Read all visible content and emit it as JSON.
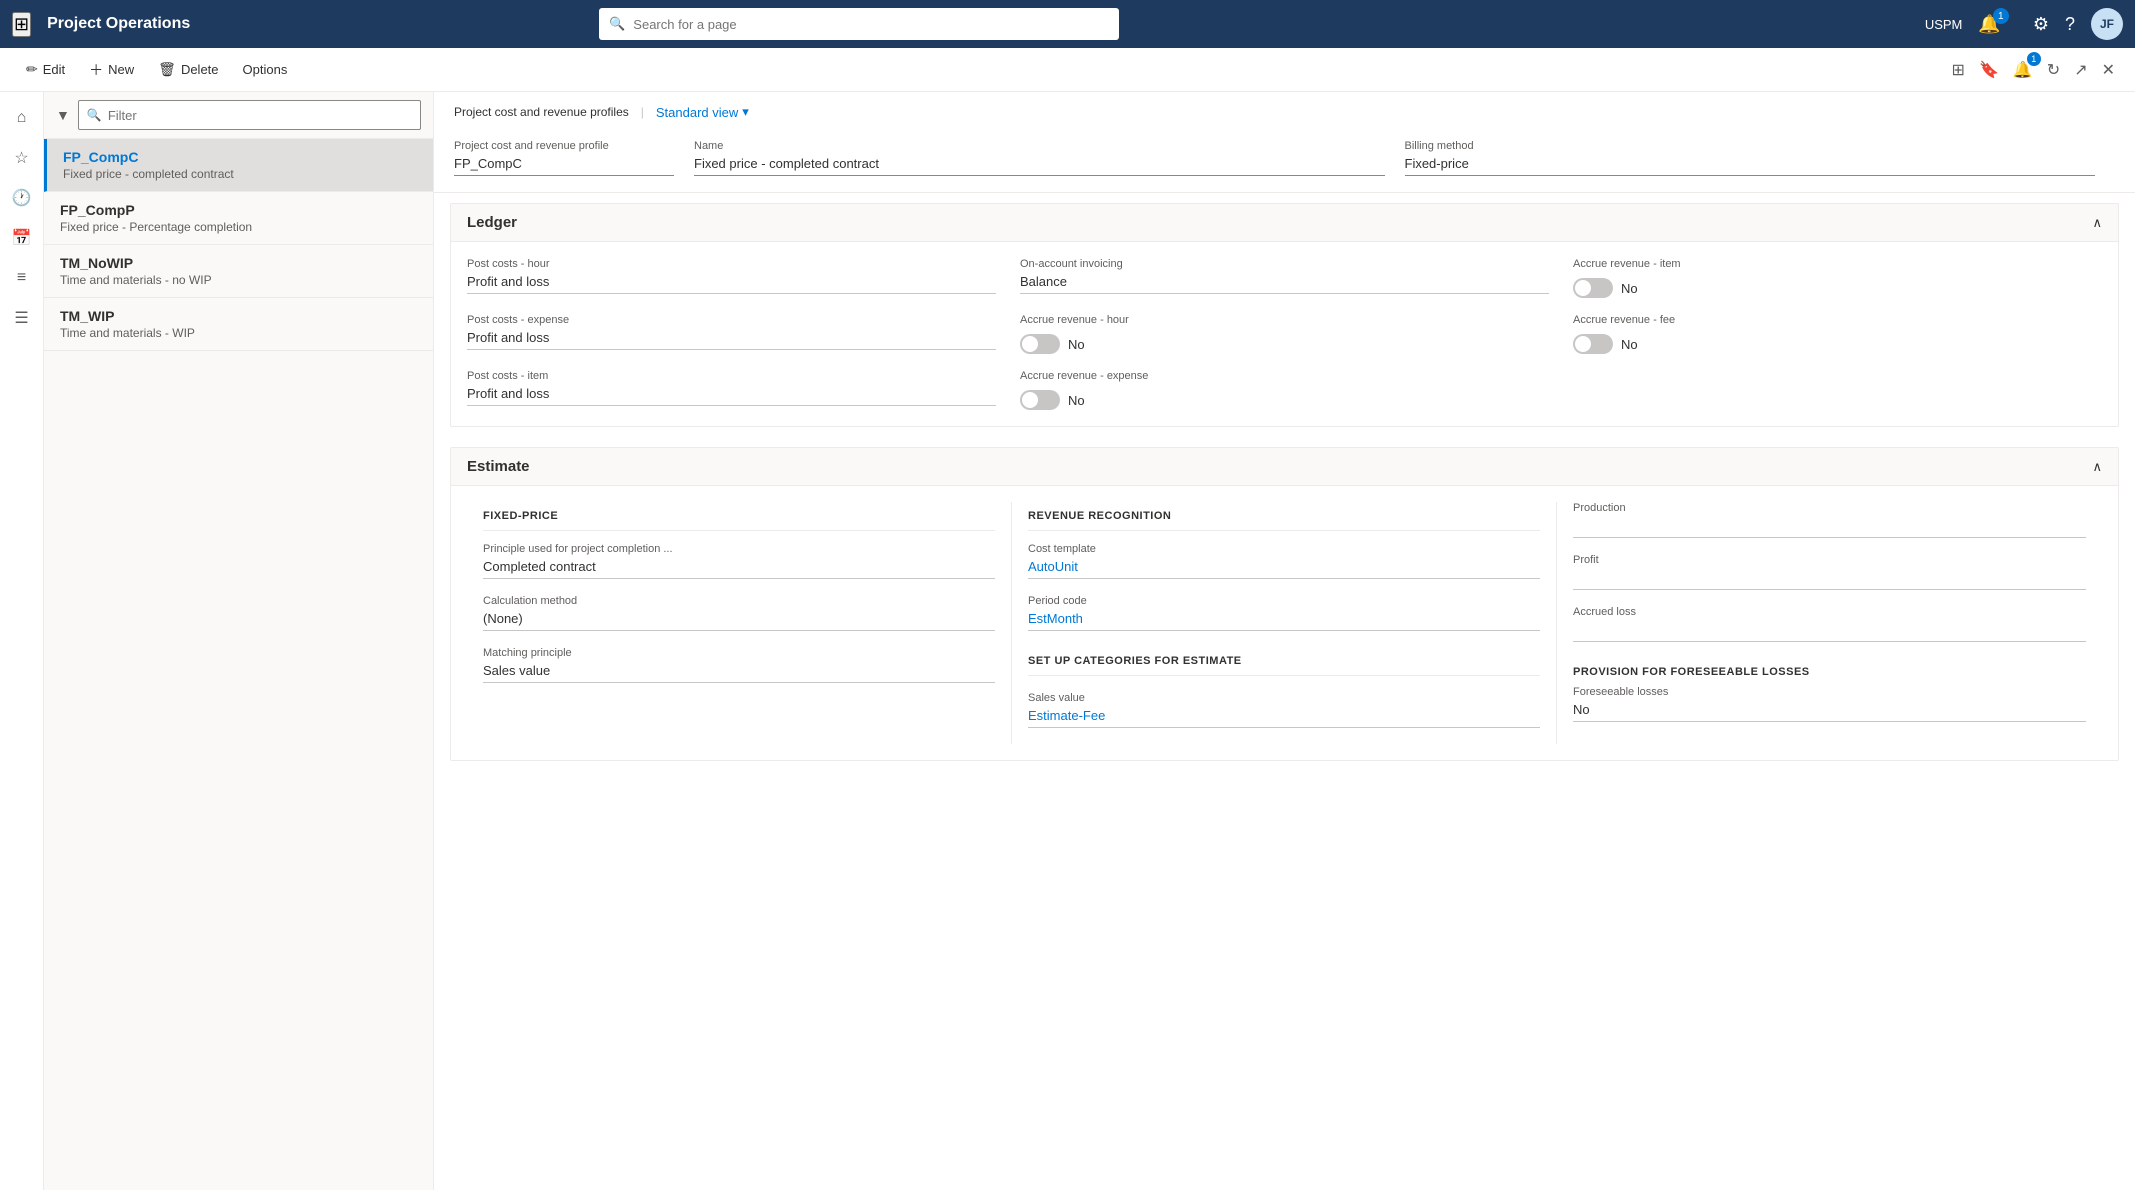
{
  "topbar": {
    "app_title": "Project Operations",
    "search_placeholder": "Search for a page",
    "user_initials": "JF",
    "username": "USPM",
    "notification_count": "1"
  },
  "commandbar": {
    "edit_label": "Edit",
    "new_label": "New",
    "delete_label": "Delete",
    "options_label": "Options"
  },
  "sidebar": {
    "filter_placeholder": "Filter",
    "items": [
      {
        "id": "fp-compc",
        "name": "FP_CompC",
        "desc": "Fixed price - completed contract",
        "selected": true
      },
      {
        "id": "fp-compp",
        "name": "FP_CompP",
        "desc": "Fixed price - Percentage completion",
        "selected": false
      },
      {
        "id": "tm-nowip",
        "name": "TM_NoWIP",
        "desc": "Time and materials - no WIP",
        "selected": false
      },
      {
        "id": "tm-wip",
        "name": "TM_WIP",
        "desc": "Time and materials - WIP",
        "selected": false
      }
    ]
  },
  "breadcrumb": {
    "parent": "Project cost and revenue profiles",
    "current": "Project cost and revenue profile"
  },
  "view_selector": "Standard view",
  "profile_form": {
    "profile_label": "Project cost and revenue profile",
    "profile_value": "FP_CompC",
    "name_label": "Name",
    "name_value": "Fixed price - completed contract",
    "billing_label": "Billing method",
    "billing_value": "Fixed-price"
  },
  "ledger": {
    "title": "Ledger",
    "post_costs_hour_label": "Post costs - hour",
    "post_costs_hour_value": "Profit and loss",
    "on_account_invoicing_label": "On-account invoicing",
    "on_account_invoicing_value": "Balance",
    "accrue_revenue_item_label": "Accrue revenue - item",
    "accrue_revenue_item_toggle": false,
    "accrue_revenue_item_value": "No",
    "post_costs_expense_label": "Post costs - expense",
    "post_costs_expense_value": "Profit and loss",
    "accrue_revenue_hour_label": "Accrue revenue - hour",
    "accrue_revenue_hour_toggle": false,
    "accrue_revenue_hour_value": "No",
    "accrue_revenue_fee_label": "Accrue revenue - fee",
    "accrue_revenue_fee_toggle": false,
    "accrue_revenue_fee_value": "No",
    "post_costs_item_label": "Post costs - item",
    "post_costs_item_value": "Profit and loss",
    "accrue_revenue_expense_label": "Accrue revenue - expense",
    "accrue_revenue_expense_toggle": false,
    "accrue_revenue_expense_value": "No"
  },
  "estimate": {
    "title": "Estimate",
    "fixed_price_header": "FIXED-PRICE",
    "revenue_recognition_header": "REVENUE RECOGNITION",
    "production_header": "Production",
    "principle_label": "Principle used for project completion ...",
    "principle_value": "Completed contract",
    "cost_template_label": "Cost template",
    "cost_template_value": "AutoUnit",
    "production_value": "",
    "calculation_method_label": "Calculation method",
    "calculation_method_value": "(None)",
    "period_code_label": "Period code",
    "period_code_value": "EstMonth",
    "profit_label": "Profit",
    "profit_value": "",
    "matching_principle_label": "Matching principle",
    "matching_principle_value": "Sales value",
    "set_up_categories_header": "SET UP CATEGORIES FOR ESTIMATE",
    "sales_value_label": "Sales value",
    "sales_value_value": "Estimate-Fee",
    "accrued_loss_label": "Accrued loss",
    "accrued_loss_value": "",
    "provision_header": "PROVISION FOR FORESEEABLE LOSSES",
    "foreseeable_losses_label": "Foreseeable losses",
    "foreseeable_losses_value": "No"
  }
}
